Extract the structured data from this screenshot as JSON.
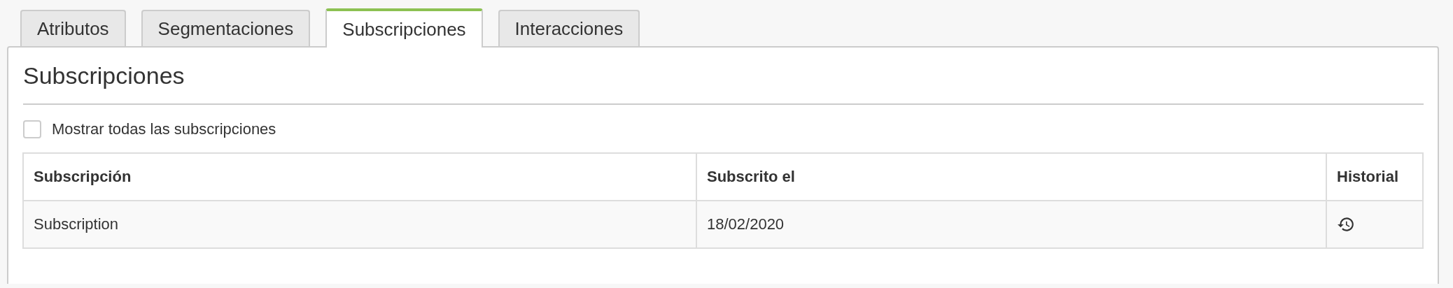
{
  "tabs": [
    {
      "label": "Atributos",
      "selected": false
    },
    {
      "label": "Segmentaciones",
      "selected": false
    },
    {
      "label": "Subscripciones",
      "selected": true
    },
    {
      "label": "Interacciones",
      "selected": false
    }
  ],
  "panel": {
    "title": "Subscripciones",
    "show_all": {
      "label": "Mostrar todas las subscripciones",
      "checked": false
    }
  },
  "table": {
    "columns": [
      "Subscripción",
      "Subscrito el",
      "Historial"
    ],
    "rows": [
      {
        "subscription": "Subscription",
        "subscribed_on": "18/02/2020"
      }
    ]
  }
}
